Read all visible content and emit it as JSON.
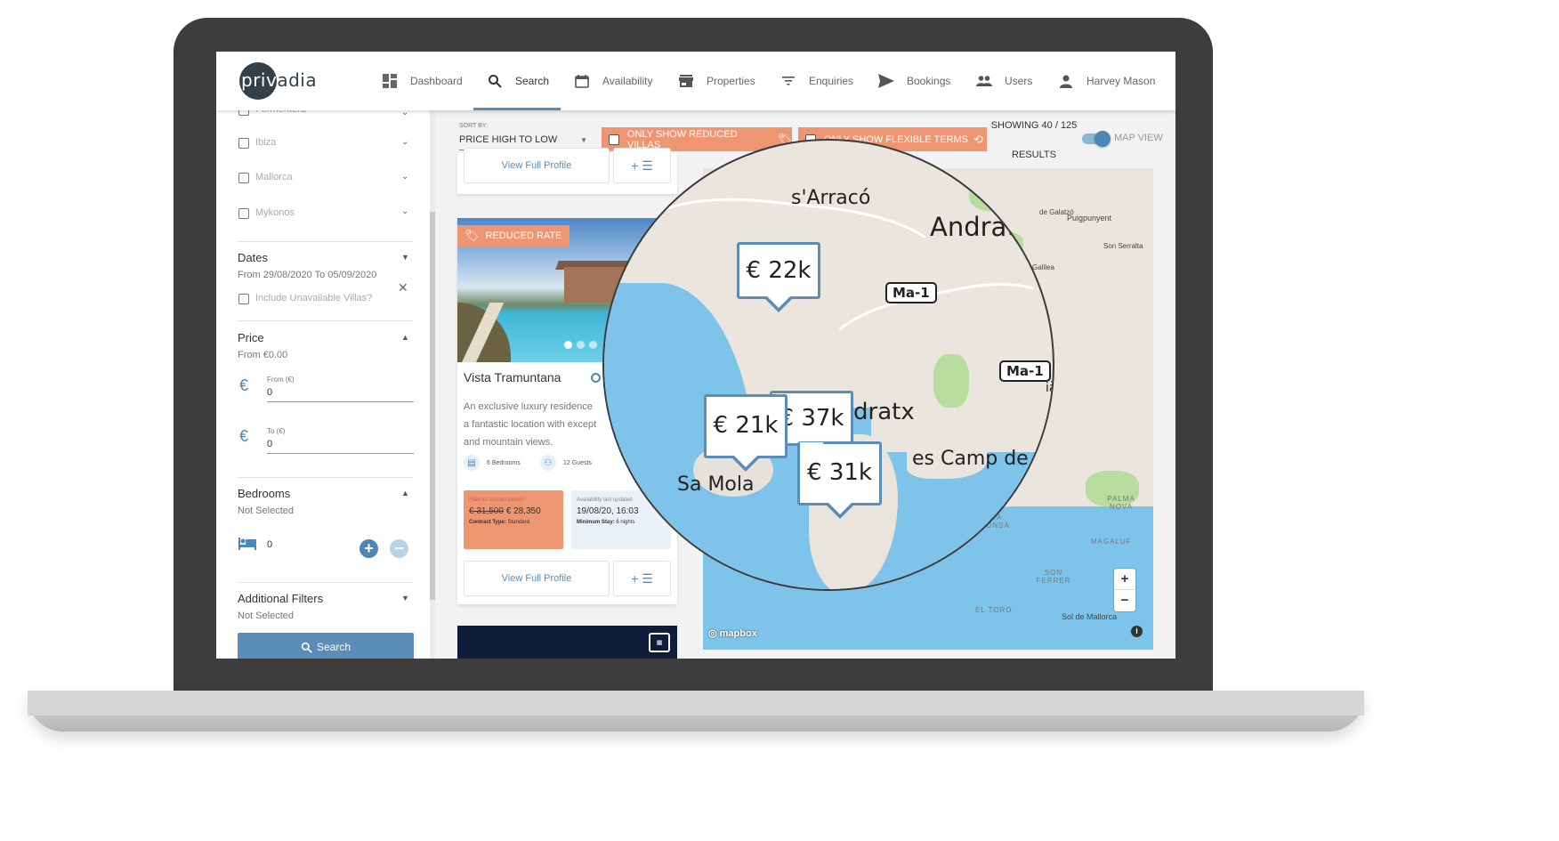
{
  "app": {
    "logo_text_light": "priv",
    "logo_text_dark": "adia"
  },
  "nav": {
    "items": [
      {
        "label": "Dashboard",
        "icon": "dashboard-icon"
      },
      {
        "label": "Search",
        "icon": "search-icon",
        "active": true
      },
      {
        "label": "Availability",
        "icon": "calendar-icon"
      },
      {
        "label": "Properties",
        "icon": "store-icon"
      },
      {
        "label": "Enquiries",
        "icon": "filter-icon"
      },
      {
        "label": "Bookings",
        "icon": "send-icon"
      },
      {
        "label": "Users",
        "icon": "people-icon"
      },
      {
        "label": "Harvey Mason",
        "icon": "person-icon"
      }
    ]
  },
  "sidebar": {
    "locations": [
      {
        "label": "Formentera"
      },
      {
        "label": "Ibiza"
      },
      {
        "label": "Mallorca"
      },
      {
        "label": "Mykonos"
      }
    ],
    "dates": {
      "title": "Dates",
      "summary": "From 29/08/2020 To 05/09/2020",
      "include_unavailable_label": "Include Unavailable Villas?"
    },
    "price": {
      "title": "Price",
      "summary": "From €0.00",
      "from_label": "From (€)",
      "from_value": "0",
      "to_label": "To (€)",
      "to_value": "0",
      "currency_symbol": "€"
    },
    "bedrooms": {
      "title": "Bedrooms",
      "summary": "Not Selected",
      "value": "0"
    },
    "additional_filters": {
      "title": "Additional Filters",
      "summary": "Not Selected"
    },
    "search_button": "Search"
  },
  "filters": {
    "sort_label": "SORT BY:",
    "sort_value": "PRICE HIGH TO LOW",
    "reduced_chip": "ONLY SHOW REDUCED VILLAS",
    "flexible_chip": "ONLY SHOW FLEXIBLE TERMS",
    "results_line1": "SHOWING 40 / 125",
    "results_line2": "RESULTS",
    "map_view_label": "MAP VIEW",
    "map_view_on": true
  },
  "listings": {
    "previous_card": {
      "view_profile": "View Full Profile",
      "add_list": "+ ☰"
    },
    "card": {
      "badge": "REDUCED RATE",
      "title": "Vista Tramuntana",
      "description_lines": [
        "An exclusive luxury residence",
        "a fantastic location with except",
        "and mountain views."
      ],
      "bedrooms": "6 Bedrooms",
      "guests": "12 Guests",
      "rate_label": "Rate for chosen period",
      "old_price": "€ 31,500",
      "new_price": "€ 28,350",
      "contract_label": "Contract Type:",
      "contract_value": "Standard",
      "avail_label": "Availability last updated",
      "avail_value": "19/08/20, 16:03",
      "min_stay_label": "Minimum Stay:",
      "min_stay_value": "6 nights",
      "view_profile": "View Full Profile",
      "add_list": "+ ☰"
    }
  },
  "map": {
    "attribution": "mapbox",
    "zoom_in": "+",
    "zoom_out": "−",
    "info": "i",
    "labels": {
      "galatzo": "de Galatzó",
      "puigpunyent": "Puigpunyent",
      "son_serralta": "Son Serralta",
      "galilea": "Galilea",
      "palma_nova": "PALMA NOVA",
      "santa_ponsa": "NTA ONSA",
      "magaluf": "MAGALUF",
      "son_ferrer": "SON FERRER",
      "el_toro": "EL TORO",
      "sol_de_mallorca": "Sol de Mallorca"
    },
    "magnified": {
      "s_arraco": "s'Arracó",
      "andratx": "Andrat",
      "andratx_port": "dratx",
      "sa_mola": "Sa Mola",
      "es_camp": "es Camp de M",
      "road1": "Ma-1",
      "road2": "Ma-1",
      "la": "ià"
    },
    "price_pins": [
      "€ 22k",
      "€ 37k",
      "€ 21k",
      "€ 31k"
    ]
  }
}
